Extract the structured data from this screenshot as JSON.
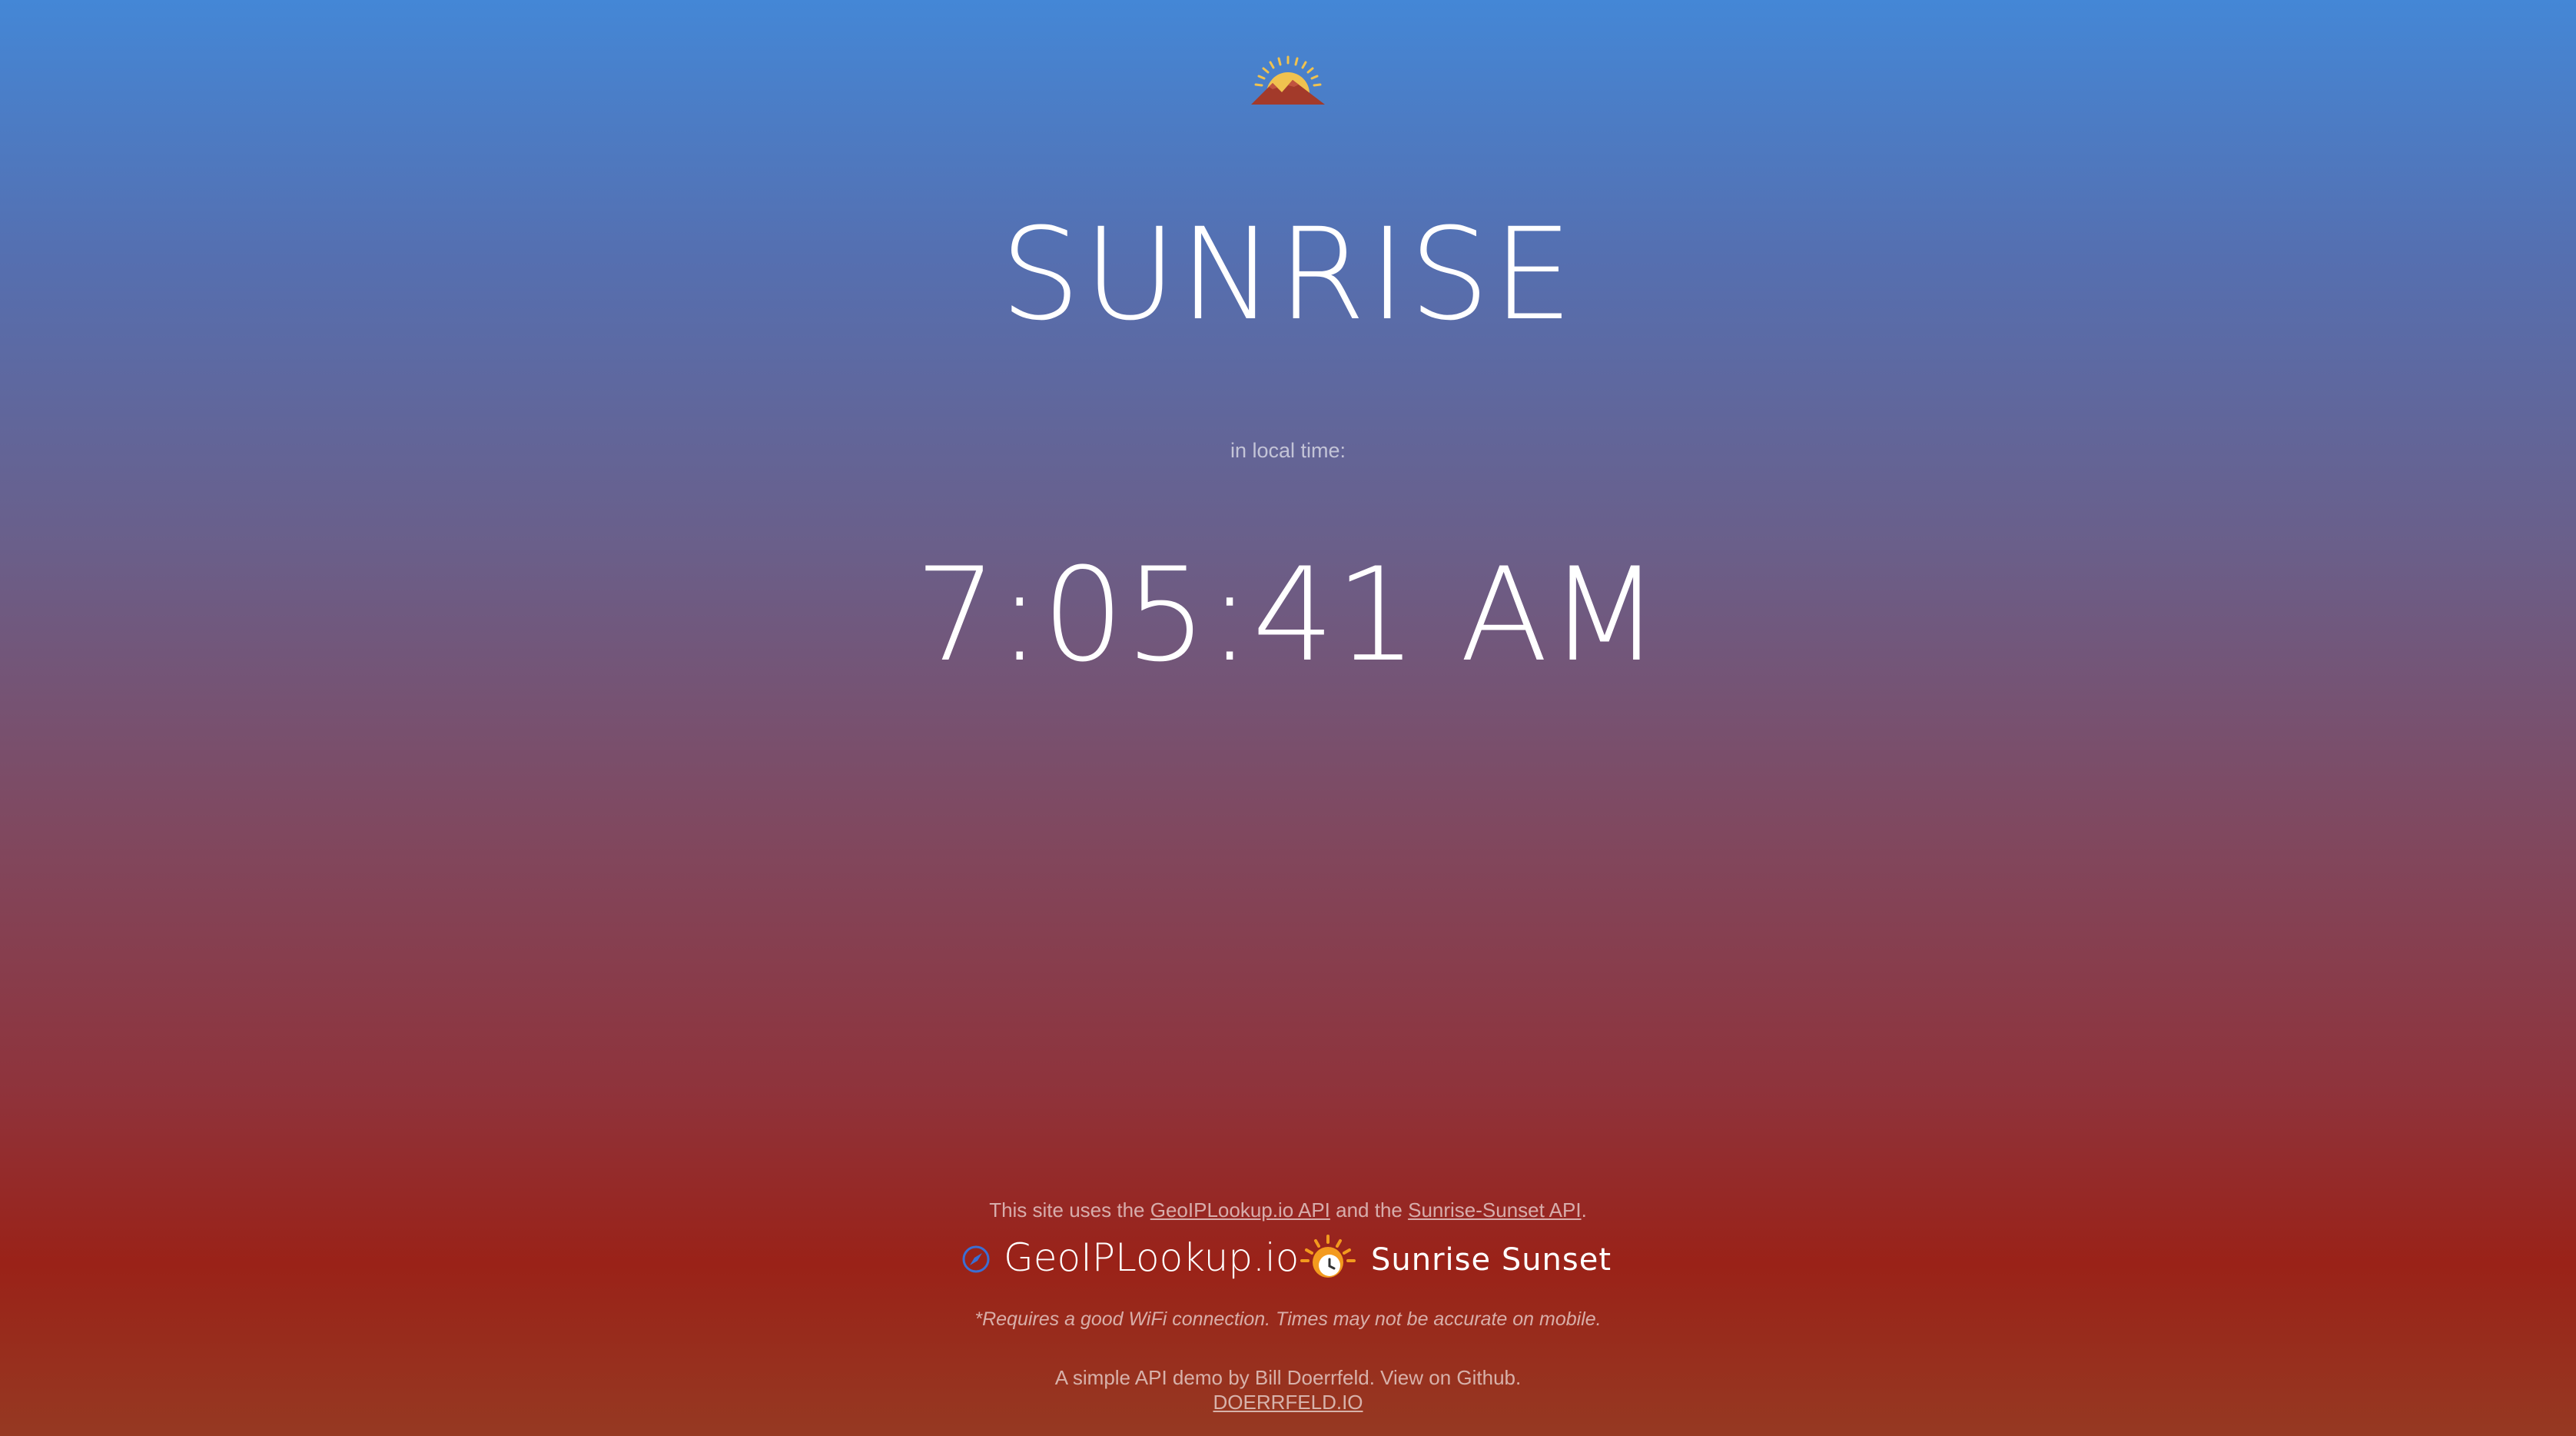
{
  "header": {
    "logo_icon": "sunrise-mountain-icon",
    "title": "SUNRISE"
  },
  "main": {
    "subtitle": "in local time:",
    "sunrise_time": "7:05:41 AM"
  },
  "footer": {
    "note_prefix": "This site uses the ",
    "geo_api_link": "GeoIPLookup.io API",
    "note_middle": " and the ",
    "sun_api_link": "Sunrise-Sunset API",
    "note_suffix": ".",
    "geo_logo_text": "GeoIPLookup.io",
    "geo_logo_icon": "compass-icon",
    "sun_logo_text": "Sunrise Sunset",
    "sun_logo_icon": "sun-clock-icon",
    "disclaimer": "*Requires a good WiFi connection. Times may not be accurate on mobile.",
    "credit": "A simple API demo by Bill Doerrfeld. View on Github.",
    "site_link": "DOERRFELD.IO"
  },
  "colors": {
    "gradient_top": "#4487d6",
    "gradient_bottom": "#9a2218",
    "logo_sun": "#f0c24f",
    "logo_mountain": "#a33a2a",
    "compass_blue": "#3b6fd4",
    "sun_orange": "#f39a1e"
  }
}
